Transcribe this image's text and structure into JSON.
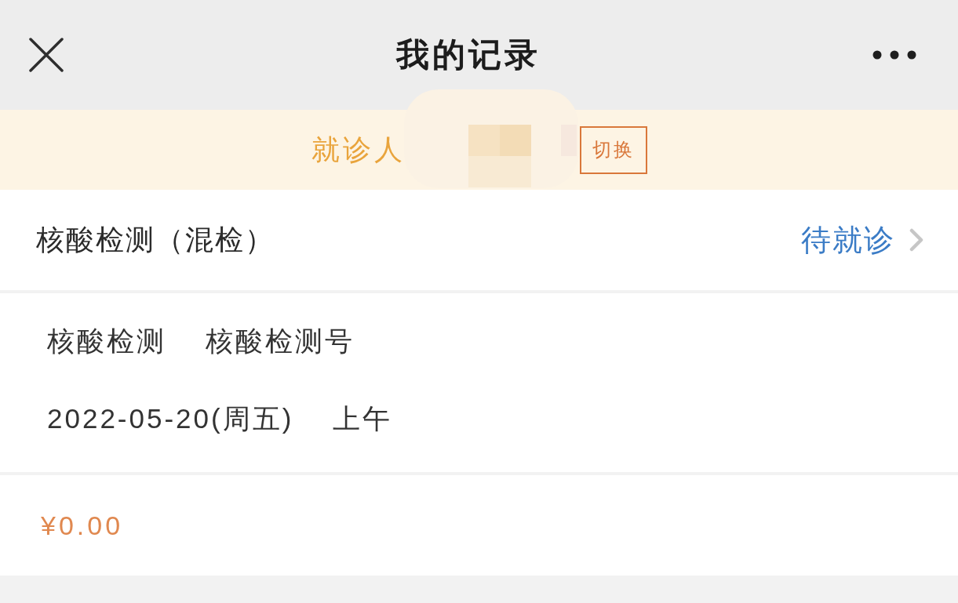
{
  "header": {
    "title": "我的记录"
  },
  "patient_bar": {
    "label": "就诊人",
    "switch_button": "切换"
  },
  "record": {
    "title": "核酸检测（混检）",
    "status": "待就诊",
    "details": [
      [
        "核酸检测",
        "核酸检测号"
      ],
      [
        "2022-05-20(周五)",
        "上午"
      ]
    ],
    "price": "¥0.00"
  }
}
